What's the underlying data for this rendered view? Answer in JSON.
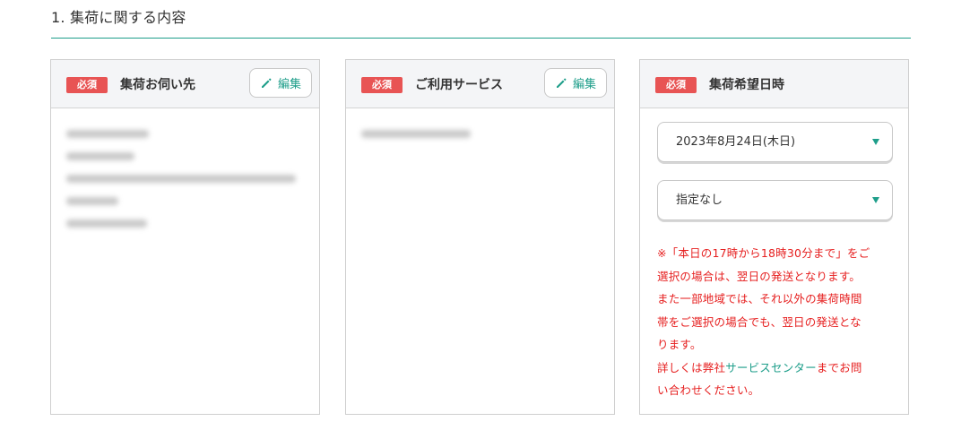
{
  "section": {
    "title": "1. 集荷に関する内容"
  },
  "colors": {
    "accent": "#1e9e8a",
    "required": "#e85454",
    "notice": "#e62020",
    "header_bg": "#f4f5f7"
  },
  "cards": {
    "pickup_location": {
      "badge": "必須",
      "title": "集荷お伺い先",
      "edit_label": "編集",
      "blurred_lines": 5
    },
    "service": {
      "badge": "必須",
      "title": "ご利用サービス",
      "edit_label": "編集",
      "blurred_lines": 1
    },
    "pickup_datetime": {
      "badge": "必須",
      "title": "集荷希望日時",
      "date_select": {
        "value": "2023年8月24日(木日)"
      },
      "time_select": {
        "value": "指定なし"
      },
      "notice_lines": [
        "※「本日の17時から18時30分まで」をご",
        "選択の場合は、翌日の発送となります。",
        "また一部地域では、それ以外の集荷時間",
        "帯をご選択の場合でも、翌日の発送とな",
        "ります。"
      ],
      "notice_last": {
        "before": "詳しくは弊社",
        "link": "サービスセンター",
        "after": "までお問",
        "line2": "い合わせください。"
      }
    }
  },
  "icons": {
    "edit": "pencil-icon",
    "dropdown": "triangle-down-icon"
  }
}
